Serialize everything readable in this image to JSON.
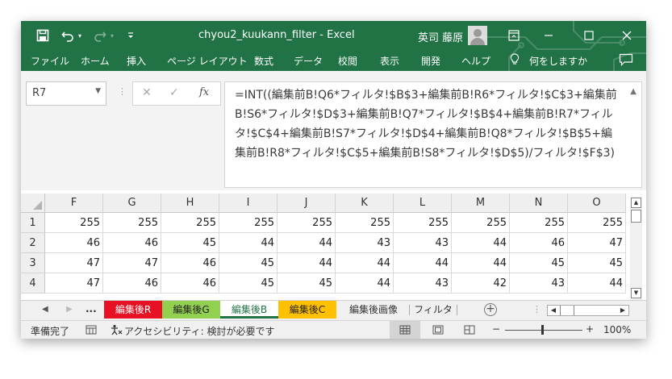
{
  "titlebar": {
    "filename": "chyou2_kuukann_filter",
    "app_sep": "-",
    "app": "Excel",
    "user": "英司 藤原"
  },
  "menu": {
    "items": [
      "ファイル",
      "ホーム",
      "挿入",
      "ページ レイアウト",
      "数式",
      "データ",
      "校閲",
      "表示",
      "開発",
      "ヘルプ"
    ],
    "tell_me": "何をしますか"
  },
  "formula_bar": {
    "name_box": "R7",
    "fx_label": "fx",
    "formula": "=INT((編集前B!Q6*フィルタ!$B$3+編集前B!R6*フィルタ!$C$3+編集前B!S6*フィルタ!$D$3+編集前B!Q7*フィルタ!$B$4+編集前B!R7*フィルタ!$C$4+編集前B!S7*フィルタ!$D$4+編集前B!Q8*フィルタ!$B$5+編集前B!R8*フィルタ!$C$5+編集前B!S8*フィルタ!$D$5)/フィルタ!$F$3)"
  },
  "sheet": {
    "columns": [
      "F",
      "G",
      "H",
      "I",
      "J",
      "K",
      "L",
      "M",
      "N",
      "O"
    ],
    "rows": [
      {
        "num": "1",
        "cells": [
          "255",
          "255",
          "255",
          "255",
          "255",
          "255",
          "255",
          "255",
          "255",
          "255"
        ]
      },
      {
        "num": "2",
        "cells": [
          "46",
          "46",
          "45",
          "44",
          "44",
          "43",
          "43",
          "44",
          "46",
          "47"
        ]
      },
      {
        "num": "3",
        "cells": [
          "47",
          "47",
          "46",
          "45",
          "44",
          "44",
          "44",
          "44",
          "45",
          "45"
        ]
      },
      {
        "num": "4",
        "cells": [
          "47",
          "46",
          "46",
          "45",
          "45",
          "44",
          "43",
          "42",
          "43",
          "44"
        ]
      }
    ]
  },
  "tabs": {
    "more": "...",
    "items": [
      {
        "label": "編集後R",
        "color": "#e81123",
        "text_color": "#ffffff"
      },
      {
        "label": "編集後G",
        "color": "#92d050",
        "text_color": "#222222"
      },
      {
        "label": "編集後B",
        "color": "#ffffff",
        "text_color": "#217346",
        "active": true
      },
      {
        "label": "編集後C",
        "color": "#ffc000",
        "text_color": "#222222"
      },
      {
        "label": "編集後画像",
        "color": "#f0f0f0",
        "text_color": "#333333"
      },
      {
        "label": "フィルタ",
        "color": "#f0f0f0",
        "text_color": "#333333"
      }
    ]
  },
  "status": {
    "ready": "準備完了",
    "accessibility": "アクセシビリティ: 検討が必要です",
    "zoom_minus": "−",
    "zoom_plus": "+",
    "zoom": "100%"
  },
  "colors": {
    "accent": "#217346"
  }
}
